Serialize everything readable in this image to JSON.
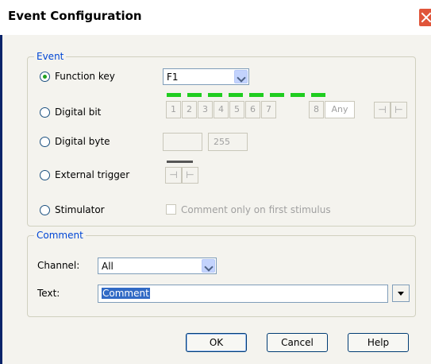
{
  "window": {
    "title": "Event Configuration"
  },
  "event_group": {
    "legend": "Event",
    "function_key": {
      "label": "Function key",
      "selected": true,
      "combo_value": "F1"
    },
    "digital_bit": {
      "label": "Digital bit",
      "bits": [
        "1",
        "2",
        "3",
        "4",
        "5",
        "6",
        "7",
        "8"
      ],
      "any_label": "Any",
      "rising_glyph": "⊣",
      "falling_glyph": "⊢"
    },
    "digital_byte": {
      "label": "Digital byte",
      "value": "",
      "max_value": "255"
    },
    "external_trigger": {
      "label": "External trigger"
    },
    "stimulator": {
      "label": "Stimulator",
      "checkbox_label": "Comment only on first stimulus"
    }
  },
  "comment_group": {
    "legend": "Comment",
    "channel": {
      "label": "Channel:",
      "value": "All"
    },
    "text": {
      "label": "Text:",
      "value": "Comment"
    }
  },
  "buttons": {
    "ok": "OK",
    "cancel": "Cancel",
    "help": "Help"
  },
  "colors": {
    "led_green": "#1fcd1f",
    "legend_blue": "#0046d5",
    "selection_blue": "#316ac5"
  }
}
